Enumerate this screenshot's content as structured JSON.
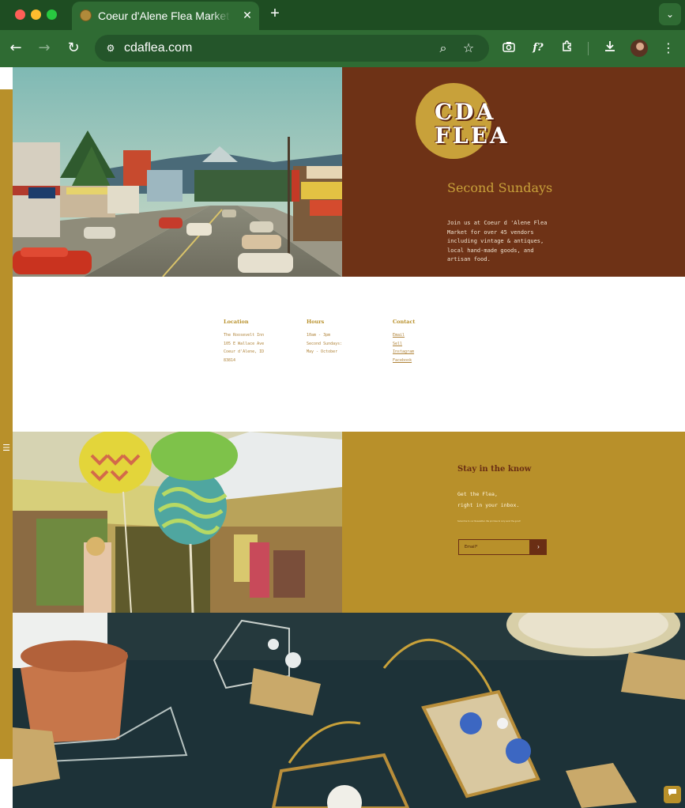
{
  "browser": {
    "tab_title": "Coeur d'Alene Flea Market | L",
    "tab_close": "✕",
    "new_tab": "+",
    "url": "cdaflea.com",
    "icons": [
      "favicon",
      "back-icon",
      "forward-icon",
      "reload-icon",
      "site-info-icon",
      "zoom-icon",
      "star-icon",
      "camera-icon",
      "font-icon",
      "extensions-icon",
      "download-icon",
      "avatar",
      "menu-icon"
    ]
  },
  "hero": {
    "logo_text": "CDA FLEA",
    "title": "Second Sundays",
    "body": "Join us at Coeur d 'Alene Flea Market for over 45 vendors including vintage & antiques, local hand-made goods, and artisan food."
  },
  "info": {
    "location": {
      "heading": "Location",
      "lines": [
        "The Roosevelt Inn",
        "105 E Wallace Ave",
        "Coeur d'Alene, ID",
        "83814"
      ]
    },
    "hours": {
      "heading": "Hours",
      "lines": [
        "10am - 3pm",
        "Second Sundays:",
        "May - October"
      ]
    },
    "contact": {
      "heading": "Contact",
      "links": [
        "Email",
        "Sell",
        "Instagram",
        "Facebook"
      ]
    }
  },
  "newsletter": {
    "title": "Stay in the know",
    "body_line1": "Get the Flea,",
    "body_line2": "right in your inbox.",
    "fine_print": "Subscribe to our Newsletter. We promise to only send the good!",
    "email_placeholder": "Email*",
    "submit_label": "›"
  },
  "colors": {
    "brown": "#6e3216",
    "gold": "#b8902a",
    "logo_gold": "#c8a13a",
    "chrome_dark": "#1e4d22",
    "chrome_light": "#2f6b33"
  }
}
